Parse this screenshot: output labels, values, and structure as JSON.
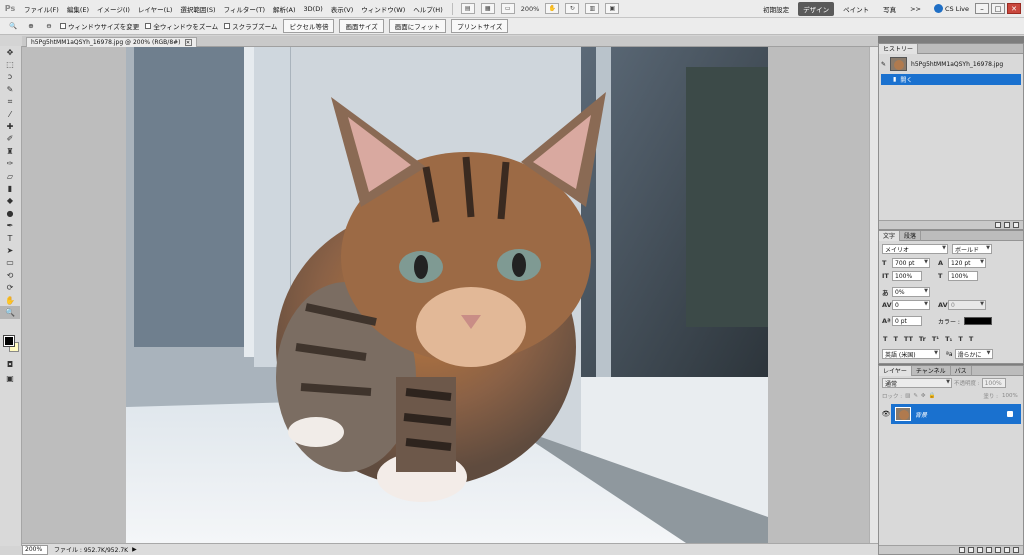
{
  "app": {
    "logo": "Ps"
  },
  "menu": [
    "ファイル(F)",
    "編集(E)",
    "イメージ(I)",
    "レイヤー(L)",
    "選択範囲(S)",
    "フィルター(T)",
    "解析(A)",
    "3D(D)",
    "表示(V)",
    "ウィンドウ(W)",
    "ヘルプ(H)"
  ],
  "appbar": {
    "zoom": "200%"
  },
  "workspace": {
    "items": [
      "初期設定",
      "デザイン",
      "ペイント",
      "写真"
    ],
    "active_index": 1,
    "more": ">>",
    "cs_live": "CS Live"
  },
  "options": {
    "checks": [
      "ウィンドウサイズを変更",
      "全ウィンドウをズーム",
      "スクラブズーム"
    ],
    "buttons": [
      "ピクセル等倍",
      "画面サイズ",
      "画面にフィット",
      "プリントサイズ"
    ]
  },
  "document": {
    "tab_title": "h5Pg5htMM1aQSYh_16978.jpg @ 200% (RGB/8#)"
  },
  "status": {
    "zoom": "200%",
    "file": "ファイル : 952.7K/952.7K"
  },
  "history": {
    "tab": "ヒストリー",
    "snapshot": "h5Pg5htMM1aQSYh_16978.jpg",
    "step": "開く"
  },
  "character": {
    "tabs": [
      "文字",
      "段落"
    ],
    "font": "メイリオ",
    "style": "ボールド",
    "size": "700 pt",
    "leading": "120 pt",
    "vscale": "100%",
    "hscale": "100%",
    "tsume": "0%",
    "tracking": "0",
    "kerning": "0",
    "baseline": "0 pt",
    "color_label": "カラー :",
    "color": "#000000",
    "style_glyphs": [
      "T",
      "T",
      "TT",
      "Tr",
      "T¹",
      "T₁",
      "T",
      "T"
    ],
    "language": "英語 (米国)",
    "aa_prefix": "ªa",
    "aa": "滑らかに"
  },
  "layers": {
    "tabs": [
      "レイヤー",
      "チャンネル",
      "パス"
    ],
    "blend": "通常",
    "opacity_label": "不透明度 :",
    "opacity": "100%",
    "lock_label": "ロック :",
    "fill_label": "塗り :",
    "fill": "100%",
    "layer_name": "背景"
  }
}
